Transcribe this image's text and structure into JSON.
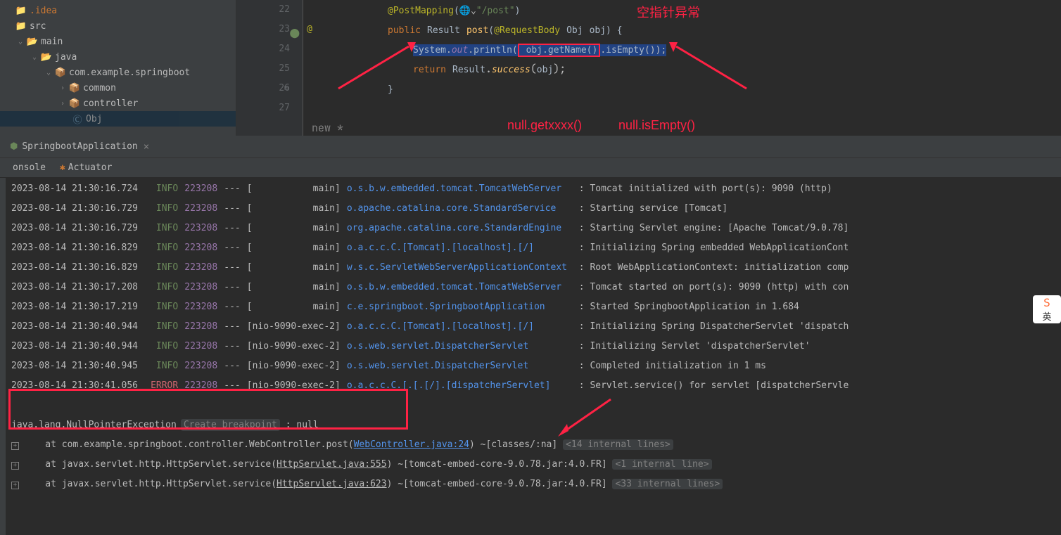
{
  "tree": {
    "idea": ".idea",
    "src": "src",
    "main": "main",
    "java": "java",
    "package": "com.example.springboot",
    "common": "common",
    "controller": "controller",
    "obj": "Obj"
  },
  "gutter": {
    "lines": [
      "22",
      "23",
      "24",
      "25",
      "26",
      "27"
    ]
  },
  "code": {
    "l22_ann": "@PostMapping",
    "l22_str": "\"/post\"",
    "l23_public": "public",
    "l23_result": "Result",
    "l23_post": "post",
    "l23_reqbody": "@RequestBody",
    "l23_obj": "Obj",
    "l23_param": "obj",
    "l24_system": "System",
    "l24_out": "out",
    "l24_println": "println",
    "l24_getname": "obj.getName()",
    "l24_isempty": "isEmpty",
    "l25_return": "return",
    "l25_result": "Result",
    "l25_success": "success",
    "l25_obj": "obj",
    "new_star": "new *"
  },
  "annotations": {
    "null_get": "null.getxxxx()",
    "null_empty": "null.isEmpty()",
    "npe_cn": "空指针异常"
  },
  "tab": {
    "title": "SpringbootApplication",
    "close": "×"
  },
  "toolbar": {
    "console": "onsole",
    "actuator": "Actuator"
  },
  "logs": [
    {
      "t": "2023-08-14 21:30:16.724",
      "lvl": "INFO",
      "pid": "223208",
      "sep": "---",
      "th": "[           main]",
      "cls": "o.s.b.w.embedded.tomcat.TomcatWebServer  ",
      "msg": ": Tomcat initialized with port(s): 9090 (http)"
    },
    {
      "t": "2023-08-14 21:30:16.729",
      "lvl": "INFO",
      "pid": "223208",
      "sep": "---",
      "th": "[           main]",
      "cls": "o.apache.catalina.core.StandardService   ",
      "msg": ": Starting service [Tomcat]"
    },
    {
      "t": "2023-08-14 21:30:16.729",
      "lvl": "INFO",
      "pid": "223208",
      "sep": "---",
      "th": "[           main]",
      "cls": "org.apache.catalina.core.StandardEngine  ",
      "msg": ": Starting Servlet engine: [Apache Tomcat/9.0.78]"
    },
    {
      "t": "2023-08-14 21:30:16.829",
      "lvl": "INFO",
      "pid": "223208",
      "sep": "---",
      "th": "[           main]",
      "cls": "o.a.c.c.C.[Tomcat].[localhost].[/]       ",
      "msg": ": Initializing Spring embedded WebApplicationCont"
    },
    {
      "t": "2023-08-14 21:30:16.829",
      "lvl": "INFO",
      "pid": "223208",
      "sep": "---",
      "th": "[           main]",
      "cls": "w.s.c.ServletWebServerApplicationContext ",
      "msg": ": Root WebApplicationContext: initialization comp"
    },
    {
      "t": "2023-08-14 21:30:17.208",
      "lvl": "INFO",
      "pid": "223208",
      "sep": "---",
      "th": "[           main]",
      "cls": "o.s.b.w.embedded.tomcat.TomcatWebServer  ",
      "msg": ": Tomcat started on port(s): 9090 (http) with con"
    },
    {
      "t": "2023-08-14 21:30:17.219",
      "lvl": "INFO",
      "pid": "223208",
      "sep": "---",
      "th": "[           main]",
      "cls": "c.e.springboot.SpringbootApplication     ",
      "msg": ": Started SpringbootApplication in 1.684 "
    },
    {
      "t": "2023-08-14 21:30:40.944",
      "lvl": "INFO",
      "pid": "223208",
      "sep": "---",
      "th": "[nio-9090-exec-2]",
      "cls": "o.a.c.c.C.[Tomcat].[localhost].[/]       ",
      "msg": ": Initializing Spring DispatcherServlet 'dispatch"
    },
    {
      "t": "2023-08-14 21:30:40.944",
      "lvl": "INFO",
      "pid": "223208",
      "sep": "---",
      "th": "[nio-9090-exec-2]",
      "cls": "o.s.web.servlet.DispatcherServlet        ",
      "msg": ": Initializing Servlet 'dispatcherServlet'"
    },
    {
      "t": "2023-08-14 21:30:40.945",
      "lvl": "INFO",
      "pid": "223208",
      "sep": "---",
      "th": "[nio-9090-exec-2]",
      "cls": "o.s.web.servlet.DispatcherServlet        ",
      "msg": ": Completed initialization in 1 ms"
    },
    {
      "t": "2023-08-14 21:30:41.056",
      "lvl": "ERROR",
      "pid": "223208",
      "sep": "---",
      "th": "[nio-9090-exec-2]",
      "cls": "o.a.c.c.C.[.[.[/].[dispatcherServlet]    ",
      "msg": ": Servlet.service() for servlet [dispatcherServle"
    }
  ],
  "exception": {
    "prefix": "java.lang.",
    "name": "NullPointerException",
    "create_bp": "Create breakpoint",
    "suffix": " : null"
  },
  "stack": [
    {
      "pre": "    at com.example.springboot.controller.WebController.post(",
      "link": "WebController.java:24",
      "post": ") ~[classes/:na] ",
      "fold": "<14 internal lines>"
    },
    {
      "pre": "    at javax.servlet.http.HttpServlet.service(",
      "link": "HttpServlet.java:555",
      "post": ") ~[tomcat-embed-core-9.0.78.jar:4.0.FR] ",
      "fold": "<1 internal line>"
    },
    {
      "pre": "    at javax.servlet.http.HttpServlet.service(",
      "link": "HttpServlet.java:623",
      "post": ") ~[tomcat-embed-core-9.0.78.jar:4.0.FR] ",
      "fold": "<33 internal lines>"
    }
  ],
  "ime": {
    "label": "英"
  }
}
